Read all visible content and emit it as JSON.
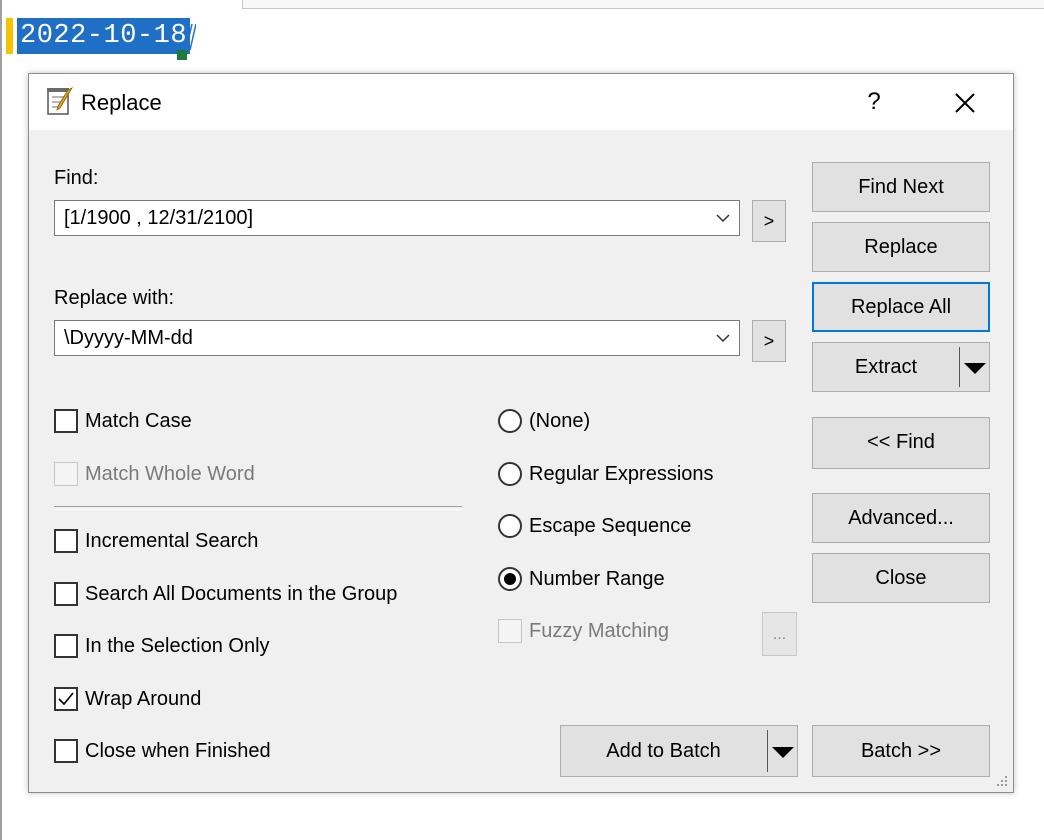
{
  "editor": {
    "selected_text": "2022-10-18"
  },
  "dialog": {
    "title": "Replace",
    "help_label": "?",
    "find_label": "Find:",
    "find_value": "[1/1900 , 12/31/2100]",
    "replace_label": "Replace with:",
    "replace_value": "\\Dyyyy-MM-dd",
    "more_button_label": ">",
    "buttons": {
      "find_next": "Find Next",
      "replace": "Replace",
      "replace_all": "Replace All",
      "extract": "Extract",
      "find_back": "<< Find",
      "advanced": "Advanced...",
      "close": "Close",
      "add_to_batch": "Add to Batch",
      "batch": "Batch >>",
      "fuzzy_options": "..."
    },
    "options": {
      "match_case": {
        "label": "Match Case",
        "checked": false
      },
      "match_whole_word": {
        "label": "Match Whole Word",
        "checked": false,
        "disabled": true
      },
      "incremental_search": {
        "label": "Incremental Search",
        "checked": false
      },
      "search_all_docs": {
        "label": "Search All Documents in the Group",
        "checked": false
      },
      "selection_only": {
        "label": "In the Selection Only",
        "checked": false
      },
      "wrap_around": {
        "label": "Wrap Around",
        "checked": true
      },
      "close_when_finished": {
        "label": "Close when Finished",
        "checked": false
      }
    },
    "modes": [
      {
        "label": "(None)",
        "selected": false
      },
      {
        "label": "Regular Expressions",
        "selected": false
      },
      {
        "label": "Escape Sequence",
        "selected": false
      },
      {
        "label": "Number Range",
        "selected": true
      }
    ],
    "fuzzy_matching": {
      "label": "Fuzzy Matching",
      "checked": false,
      "disabled": true
    },
    "colors": {
      "selection_bg": "#1f6fc5",
      "focus_border": "#0078d7",
      "gutter_mark": "#f5c400"
    }
  }
}
